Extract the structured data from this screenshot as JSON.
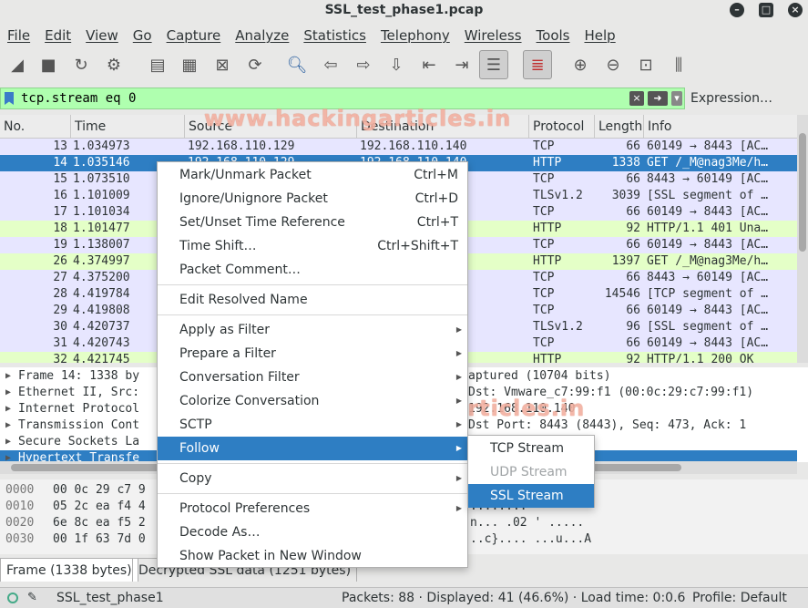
{
  "window": {
    "title": "SSL_test_phase1.pcap"
  },
  "menubar": [
    "File",
    "Edit",
    "View",
    "Go",
    "Capture",
    "Analyze",
    "Statistics",
    "Telephony",
    "Wireless",
    "Tools",
    "Help"
  ],
  "filter": {
    "value": "tcp.stream eq 0",
    "expression_label": "Expression…"
  },
  "packet_list": {
    "columns": [
      "No.",
      "Time",
      "Source",
      "Destination",
      "Protocol",
      "Length",
      "Info"
    ],
    "rows": [
      {
        "no": "13",
        "time": "1.034973",
        "src": "192.168.110.129",
        "dst": "192.168.110.140",
        "proto": "TCP",
        "len": "66",
        "info": "60149 → 8443 [AC…"
      },
      {
        "no": "14",
        "time": "1.035146",
        "src": "192.168.110.129",
        "dst": "192.168.110.140",
        "proto": "HTTP",
        "len": "1338",
        "info": "GET /_M@nag3Me/h…"
      },
      {
        "no": "15",
        "time": "1.073510",
        "src": "",
        "dst": "29",
        "proto": "TCP",
        "len": "66",
        "info": "8443 → 60149 [AC…"
      },
      {
        "no": "16",
        "time": "1.101009",
        "src": "",
        "dst": "29",
        "proto": "TLSv1.2",
        "len": "3039",
        "info": "[SSL segment of …"
      },
      {
        "no": "17",
        "time": "1.101034",
        "src": "",
        "dst": "40",
        "proto": "TCP",
        "len": "66",
        "info": "60149 → 8443 [AC…"
      },
      {
        "no": "18",
        "time": "1.101477",
        "src": "",
        "dst": "29",
        "proto": "HTTP",
        "len": "92",
        "info": "HTTP/1.1 401 Una…"
      },
      {
        "no": "19",
        "time": "1.138007",
        "src": "",
        "dst": "40",
        "proto": "TCP",
        "len": "66",
        "info": "60149 → 8443 [AC…"
      },
      {
        "no": "26",
        "time": "4.374997",
        "src": "",
        "dst": "40",
        "proto": "HTTP",
        "len": "1397",
        "info": "GET /_M@nag3Me/h…"
      },
      {
        "no": "27",
        "time": "4.375200",
        "src": "",
        "dst": "29",
        "proto": "TCP",
        "len": "66",
        "info": "8443 → 60149 [AC…"
      },
      {
        "no": "28",
        "time": "4.419784",
        "src": "",
        "dst": "29",
        "proto": "TCP",
        "len": "14546",
        "info": "[TCP segment of …"
      },
      {
        "no": "29",
        "time": "4.419808",
        "src": "",
        "dst": "40",
        "proto": "TCP",
        "len": "66",
        "info": "60149 → 8443 [AC…"
      },
      {
        "no": "30",
        "time": "4.420737",
        "src": "",
        "dst": "29",
        "proto": "TLSv1.2",
        "len": "96",
        "info": "[SSL segment of …"
      },
      {
        "no": "31",
        "time": "4.420743",
        "src": "",
        "dst": "40",
        "proto": "TCP",
        "len": "66",
        "info": "60149 → 8443 [AC…"
      },
      {
        "no": "32",
        "time": "4.421745",
        "src": "",
        "dst": "29",
        "proto": "HTTP",
        "len": "92",
        "info": "HTTP/1.1 200 OK"
      }
    ]
  },
  "details": [
    {
      "text": "Frame 14: 1338 by",
      "right": "aptured (10704 bits)"
    },
    {
      "text": "Ethernet II, Src:",
      "right": "Dst: Vmware_c7:99:f1 (00:0c:29:c7:99:f1)"
    },
    {
      "text": "Internet Protocol",
      "right": "192.168.110.140"
    },
    {
      "text": "Transmission Cont",
      "right": "Dst Port: 8443 (8443), Seq: 473, Ack: 1"
    },
    {
      "text": "Secure Sockets La",
      "right": ""
    },
    {
      "text": "Hypertext Transfe",
      "right": ""
    }
  ],
  "bytes": [
    {
      "off": "0000",
      "hex": "00 0c 29 c7 9",
      "ascii": "E."
    },
    {
      "off": "0010",
      "hex": "05 2c ea f4 4",
      "ascii": "........"
    },
    {
      "off": "0020",
      "hex": "6e 8c ea f5 2",
      "ascii": "n... .02 ' ....."
    },
    {
      "off": "0030",
      "hex": "00 1f 63 7d 0",
      "ascii": "..c}.... ...u...A"
    }
  ],
  "byte_tabs": [
    "Frame (1338 bytes)",
    "Decrypted SSL data (1251 bytes)"
  ],
  "status": {
    "file": "SSL_test_phase1",
    "packets": "Packets: 88 · Displayed: 41 (46.6%) · Load time: 0:0.6",
    "profile": "Profile: Default"
  },
  "context_menu": {
    "items": [
      {
        "label": "Mark/Unmark Packet",
        "acc": "Ctrl+M"
      },
      {
        "label": "Ignore/Unignore Packet",
        "acc": "Ctrl+D"
      },
      {
        "label": "Set/Unset Time Reference",
        "acc": "Ctrl+T"
      },
      {
        "label": "Time Shift…",
        "acc": "Ctrl+Shift+T"
      },
      {
        "label": "Packet Comment…",
        "acc": ""
      },
      {
        "label": "Edit Resolved Name",
        "acc": ""
      },
      {
        "label": "Apply as Filter",
        "acc": ""
      },
      {
        "label": "Prepare a Filter",
        "acc": ""
      },
      {
        "label": "Conversation Filter",
        "acc": ""
      },
      {
        "label": "Colorize Conversation",
        "acc": ""
      },
      {
        "label": "SCTP",
        "acc": ""
      },
      {
        "label": "Follow",
        "acc": ""
      },
      {
        "label": "Copy",
        "acc": ""
      },
      {
        "label": "Protocol Preferences",
        "acc": ""
      },
      {
        "label": "Decode As…",
        "acc": ""
      },
      {
        "label": "Show Packet in New Window",
        "acc": ""
      }
    ]
  },
  "follow_submenu": [
    "TCP Stream",
    "UDP Stream",
    "SSL Stream"
  ],
  "watermark": "www.hackingarticles.in",
  "colors": {
    "selection": "#2e7ec3",
    "filter_ok": "#afffaf",
    "tcp_row": "#e7e6ff",
    "http_row": "#e4ffc7"
  }
}
